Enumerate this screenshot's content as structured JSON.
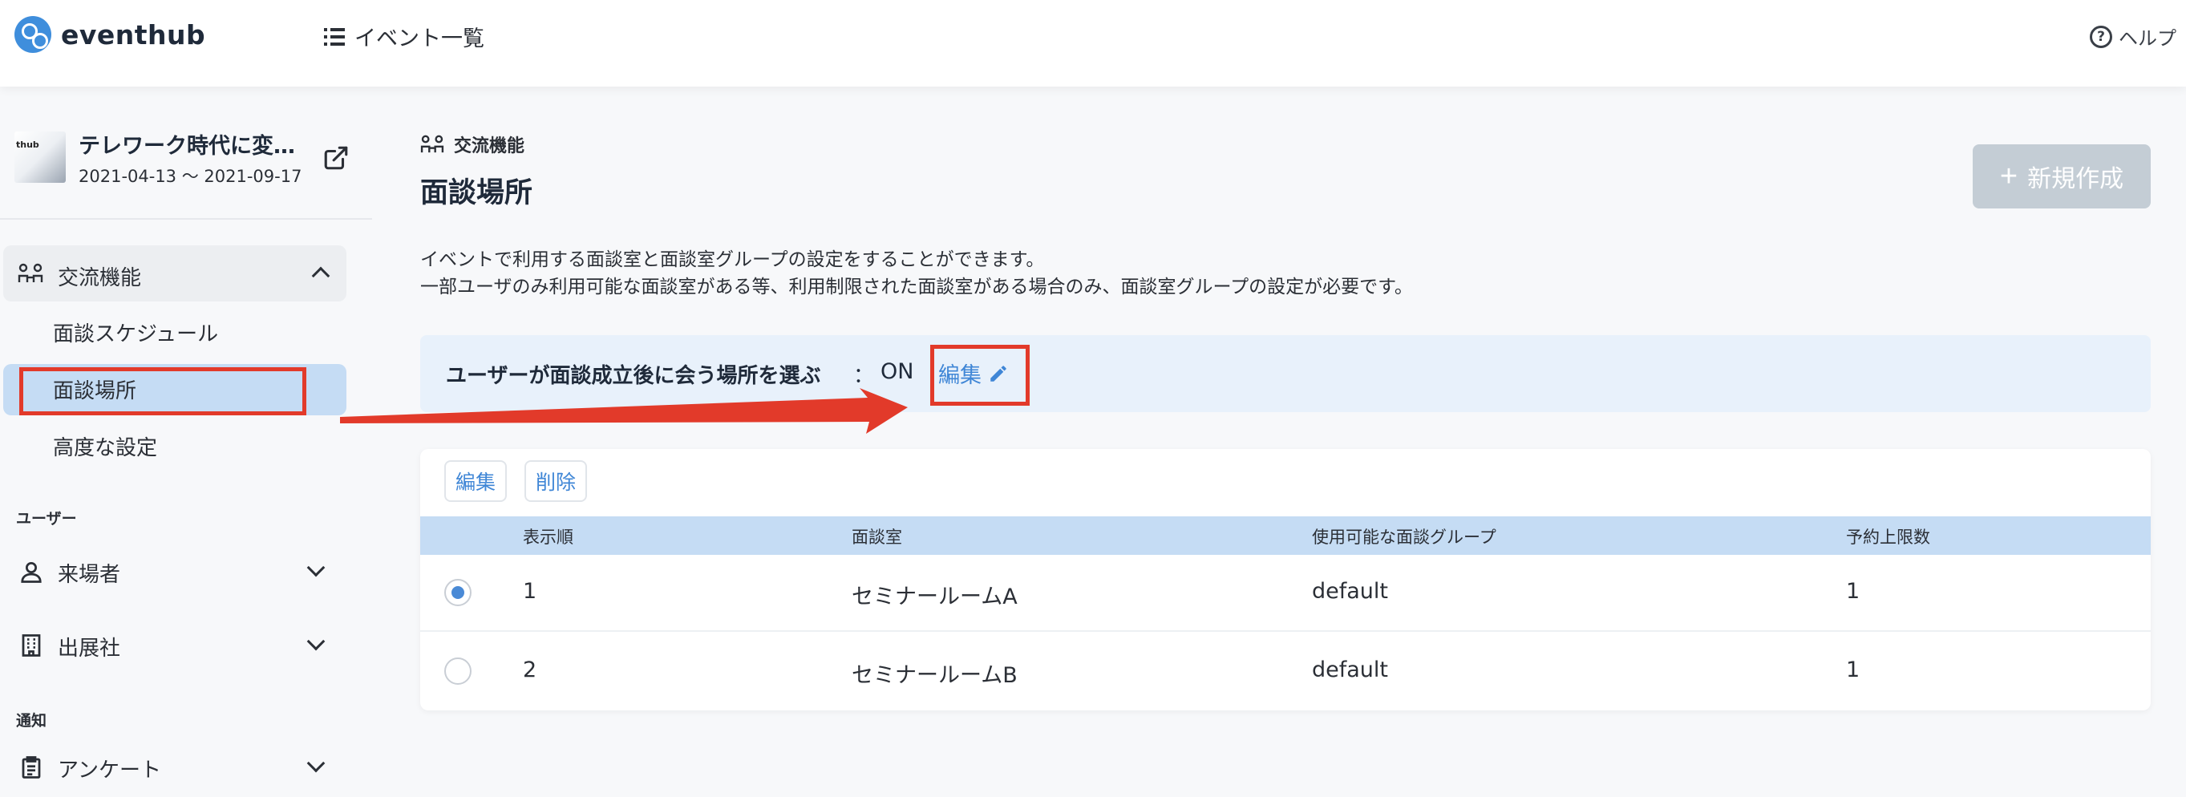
{
  "header": {
    "brand": "eventhub",
    "nav_events_label": "イベント一覧",
    "help_label": "ヘルプ",
    "help_icon_glyph": "?"
  },
  "sidebar": {
    "event": {
      "thumb_text": "thub",
      "title": "テレワーク時代に変…",
      "dates": "2021-04-13 〜 2021-09-17"
    },
    "group_interaction": {
      "label": "交流機能",
      "expanded": true,
      "items": [
        {
          "label": "面談スケジュール",
          "active": false
        },
        {
          "label": "面談場所",
          "active": true
        },
        {
          "label": "高度な設定",
          "active": false
        }
      ]
    },
    "section_users": {
      "label": "ユーザー",
      "items": [
        {
          "label": "来場者",
          "icon": "person-icon"
        },
        {
          "label": "出展社",
          "icon": "building-icon"
        }
      ]
    },
    "section_notice": {
      "label": "通知",
      "items": [
        {
          "label": "アンケート",
          "icon": "clipboard-icon"
        }
      ]
    }
  },
  "main": {
    "breadcrumb": "交流機能",
    "title": "面談場所",
    "new_button_label": "新規作成",
    "description_line1": "イベントで利用する面談室と面談室グループの設定をすることができます。",
    "description_line2": "一部ユーザのみ利用可能な面談室がある等、利用制限された面談室がある場合のみ、面談室グループの設定が必要です。",
    "setting": {
      "label": "ユーザーが面談成立後に会う場所を選ぶ",
      "colon": "：",
      "value": "ON",
      "edit_label": "編集"
    },
    "table": {
      "edit_button": "編集",
      "delete_button": "削除",
      "columns": [
        "表示順",
        "面談室",
        "使用可能な面談グループ",
        "予約上限数"
      ],
      "rows": [
        {
          "selected": true,
          "order": "1",
          "room": "セミナールームA",
          "group": "default",
          "limit": "1"
        },
        {
          "selected": false,
          "order": "2",
          "room": "セミナールームB",
          "group": "default",
          "limit": "1"
        }
      ]
    }
  },
  "colors": {
    "accent": "#3f86d6",
    "active_bg": "#c5dcf4",
    "annotation_red": "#e23a2a",
    "disabled_button": "#c4cdd5"
  }
}
